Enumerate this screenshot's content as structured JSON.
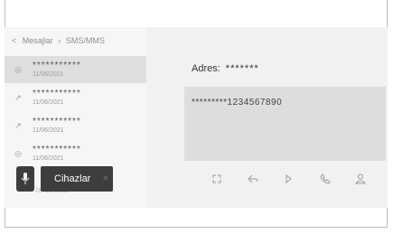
{
  "breadcrumb": {
    "back_glyph": "<",
    "root": "Mesajlar",
    "separator": "›",
    "current": "SMS/MMS"
  },
  "messages": [
    {
      "name": "***********",
      "date": "11/06/2021",
      "icon": "received-message-icon",
      "glyph": "◎",
      "selected": true
    },
    {
      "name": "***********",
      "date": "11/06/2021",
      "icon": "sent-arrow-icon",
      "glyph": "↗",
      "selected": false
    },
    {
      "name": "***********",
      "date": "11/06/2021",
      "icon": "sent-arrow-icon",
      "glyph": "↗",
      "selected": false
    },
    {
      "name": "***********",
      "date": "11/06/2021",
      "icon": "received-message-icon",
      "glyph": "◎",
      "selected": false
    }
  ],
  "overflow_date": "09/06/2021",
  "footer": {
    "clear_label": "Cihazlar",
    "close_glyph": "✕"
  },
  "detail": {
    "address_label": "Adres:",
    "address_value": "*******",
    "message_text": "*********1234567890"
  },
  "toolbar": {
    "expand": "expand-icon",
    "reply": "reply-icon",
    "play": "play-icon",
    "call": "phone-icon",
    "contact": "contact-icon"
  },
  "colors": {
    "selected_row": "#dedede",
    "button": "#3d3d3d",
    "message_box": "#dddddd"
  }
}
